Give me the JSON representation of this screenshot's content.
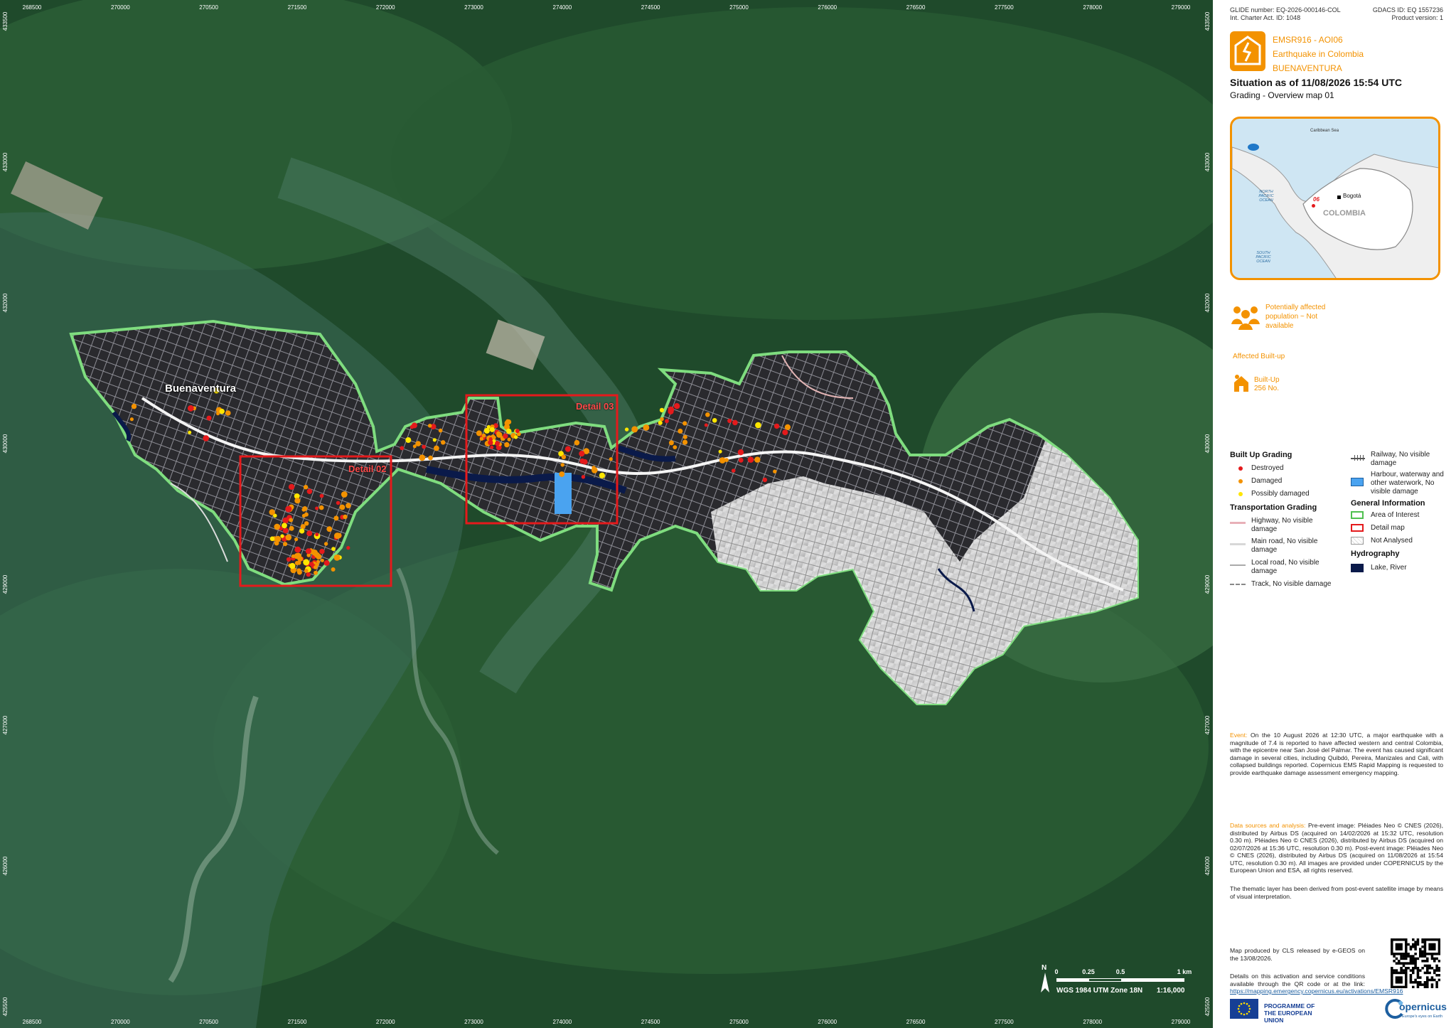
{
  "map": {
    "place_label": "Buenaventura",
    "detail_02_label": "Detail 02",
    "detail_03_label": "Detail 03",
    "ticks_top": [
      "268500",
      "270000",
      "270500",
      "271500",
      "272000",
      "273000",
      "274000",
      "274500",
      "275000",
      "276000",
      "276500",
      "277500",
      "278000",
      "279000"
    ],
    "ticks_left": [
      "433500",
      "433000",
      "432000",
      "430000",
      "429000",
      "427000",
      "426000",
      "425500"
    ],
    "ticks_right": [
      "433500",
      "433000",
      "432000",
      "430000",
      "429000",
      "427000",
      "426000",
      "425500"
    ],
    "scale": {
      "north": "N",
      "labels": [
        "0",
        "0.25",
        "0.5",
        "1 km"
      ],
      "projection": "WGS 1984 UTM Zone 18N",
      "ratio": "1:16,000"
    },
    "colors": {
      "destroyed": "#e41a1c",
      "damaged": "#f39200",
      "possibly_damaged": "#ffe600",
      "aoi": "#7fdd7f",
      "detail_map": "#e41a1c",
      "waterway": "#4aa3f0",
      "lake": "#0a1a4a"
    }
  },
  "panel": {
    "glide_label": "GLIDE number:",
    "glide": "EQ-2026-000146-COL",
    "charter_label": "Int. Charter Act. ID:",
    "charter": "1048",
    "gdacs_label": "GDACS ID:",
    "gdacs": "EQ 1557236",
    "product_label": "Product version:",
    "product": "1",
    "code": "EMSR916 - AOI06",
    "event_name": "Earthquake in Colombia",
    "aoi_name": "BUENAVENTURA",
    "situation": "Situation as of 11/08/2026 15:54 UTC",
    "subtitle": "Grading - Overview map 01",
    "inset": {
      "caribbean": "Caribbean Sea",
      "north_pacific": "NORTH PACIFIC OCEAN",
      "south_pacific": "SOUTH PACIFIC OCEAN",
      "capital": "Bogotá",
      "country": "COLOMBIA",
      "aoi_marker": "06"
    },
    "population": "Potentially affected population ~ Not available",
    "affected_builtup": "Affected Built-up",
    "builtup_label": "Built-Up",
    "builtup_count": "256 No.",
    "legend": {
      "built_up_grading": "Built Up Grading",
      "destroyed": "Destroyed",
      "damaged": "Damaged",
      "possibly_damaged": "Possibly damaged",
      "transportation_grading": "Transportation Grading",
      "highway": "Highway, No visible damage",
      "main_road": "Main road, No visible damage",
      "local_road": "Local road, No visible damage",
      "track": "Track, No visible damage",
      "railway": "Railway, No visible damage",
      "harbour": "Harbour, waterway and other waterwork, No visible damage",
      "general_information": "General Information",
      "aoi": "Area of Interest",
      "detail_map": "Detail map",
      "not_analysed": "Not Analysed",
      "hydrography": "Hydrography",
      "lake_river": "Lake, River"
    },
    "event_label": "Event:",
    "event_text": "On the 10 August 2026 at 12:30 UTC, a major earthquake with a magnitude of 7.4 is reported to have affected western and central Colombia, with the epicentre near San José del Palmar. The event has caused significant damage in several cities, including Quibdó, Pereira, Manizales and Cali, with collapsed buildings reported. Copernicus EMS Rapid Mapping is requested to provide earthquake damage assessment emergency mapping.",
    "sources_label": "Data sources and analysis:",
    "sources_text": "Pre-event image: Pléiades Neo © CNES (2026), distributed by Airbus DS (acquired on 14/02/2026 at 15:32 UTC, resolution 0.30 m). Pléiades Neo © CNES (2026), distributed by Airbus DS (acquired on 02/07/2026 at 15:36 UTC, resolution 0.30 m). Post-event image: Pléiades Neo © CNES (2026), distributed by Airbus DS (acquired on 11/08/2026 at 15:54 UTC, resolution 0.30 m). All images are provided under COPERNICUS by the European Union and ESA, all rights reserved.",
    "thematic_text": "The thematic layer has been derived from post-event satellite image by means of visual interpretation.",
    "produced_by": "Map produced by CLS released by e-GEOS on the 13/08/2026.",
    "details_text": "Details on this activation and service conditions available through the QR code or at the link:",
    "details_link": "https://mapping.emergency.copernicus.eu/activations/EMSR916",
    "eu_programme": "PROGRAMME OF THE EUROPEAN UNION",
    "copernicus": "opernicus",
    "copernicus_sub": "Europe's eyes on Earth"
  }
}
